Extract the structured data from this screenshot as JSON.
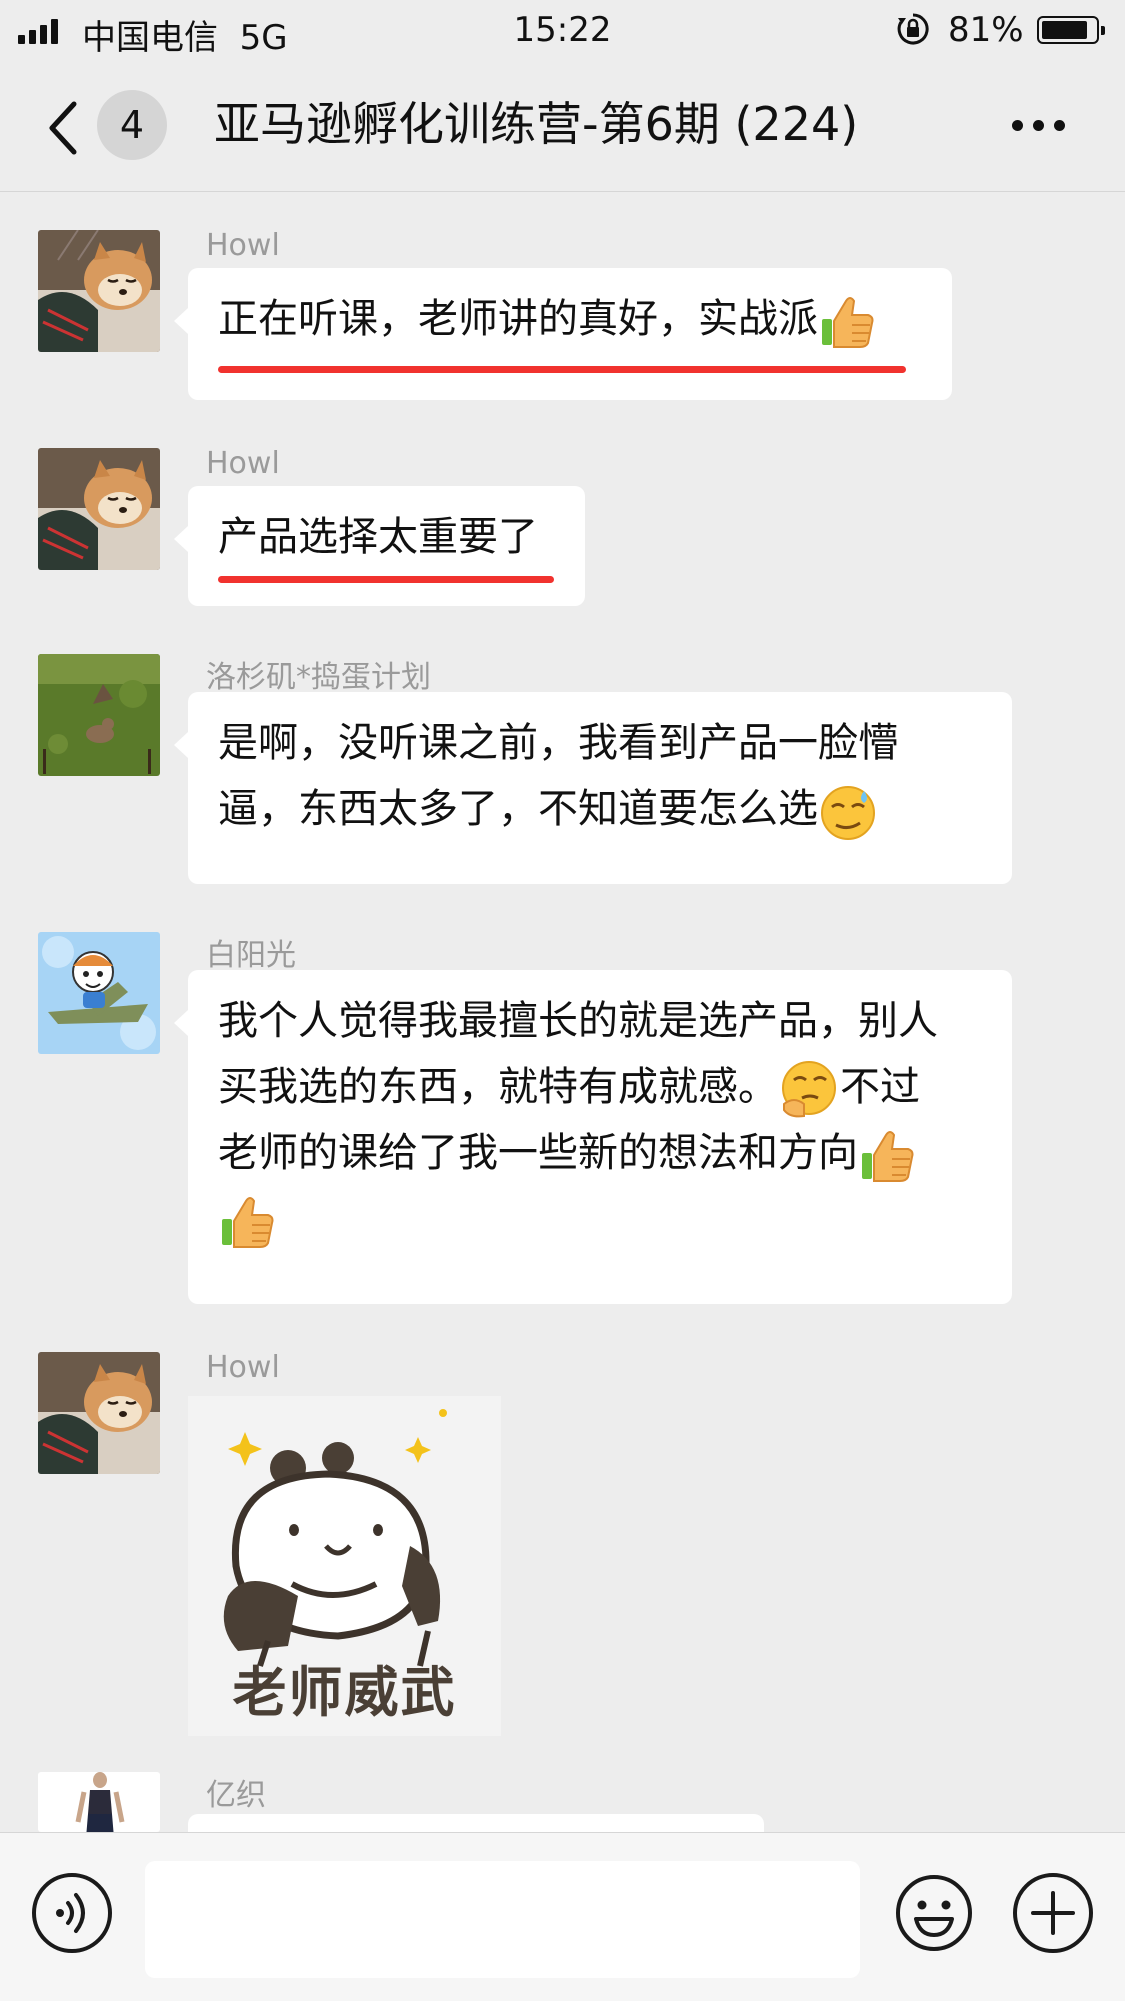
{
  "status_bar": {
    "carrier": "中国电信",
    "network": "5G",
    "time": "15:22",
    "battery_text": "81%",
    "battery_level": 0.81,
    "icons": [
      "signal-icon",
      "rotation-lock-icon",
      "battery-icon"
    ]
  },
  "nav": {
    "unread_count": "4",
    "title": "亚马逊孵化训练营-第6期 (224)",
    "icons": [
      "back-chevron-icon",
      "more-icon"
    ]
  },
  "colors": {
    "background": "#ededed",
    "bubble": "#ffffff",
    "underline": "#f1322e",
    "sender_name": "#9a9a9a"
  },
  "messages": [
    {
      "sender": "Howl",
      "avatar": "shiba-dog-avatar",
      "lines": [
        "正在听课，老师讲的真好，实战派"
      ],
      "trailing_emoji": "thumbs-up-emoji",
      "underlined": true
    },
    {
      "sender": "Howl",
      "avatar": "shiba-dog-avatar",
      "lines": [
        "产品选择太重要了"
      ],
      "underlined": true
    },
    {
      "sender": "洛杉矶*捣蛋计划",
      "avatar": "dog-field-avatar",
      "lines": [
        "是啊，没听课之前，我看到产品一脸懵",
        "逼，东西太多了，不知道要怎么选"
      ],
      "trailing_emoji": "smirk-sweat-emoji"
    },
    {
      "sender": "白阳光",
      "avatar": "cartoon-pilot-avatar",
      "lines": [
        "我个人觉得我最擅长的就是选产品，别人",
        "买我选的东西，就特有成就感。",
        "不过",
        "老师的课给了我一些新的想法和方向"
      ],
      "emojis": [
        "thinking-emoji",
        "thumbs-up-emoji",
        "thumbs-up-emoji"
      ]
    },
    {
      "sender": "Howl",
      "avatar": "shiba-dog-avatar",
      "sticker_text": "老师威武",
      "sticker": "panda-sticker"
    },
    {
      "sender": "亿织",
      "avatar": "woman-photo-avatar"
    }
  ],
  "input_bar": {
    "icons": [
      "voice-icon",
      "emoji-icon",
      "plus-icon"
    ],
    "value": ""
  }
}
